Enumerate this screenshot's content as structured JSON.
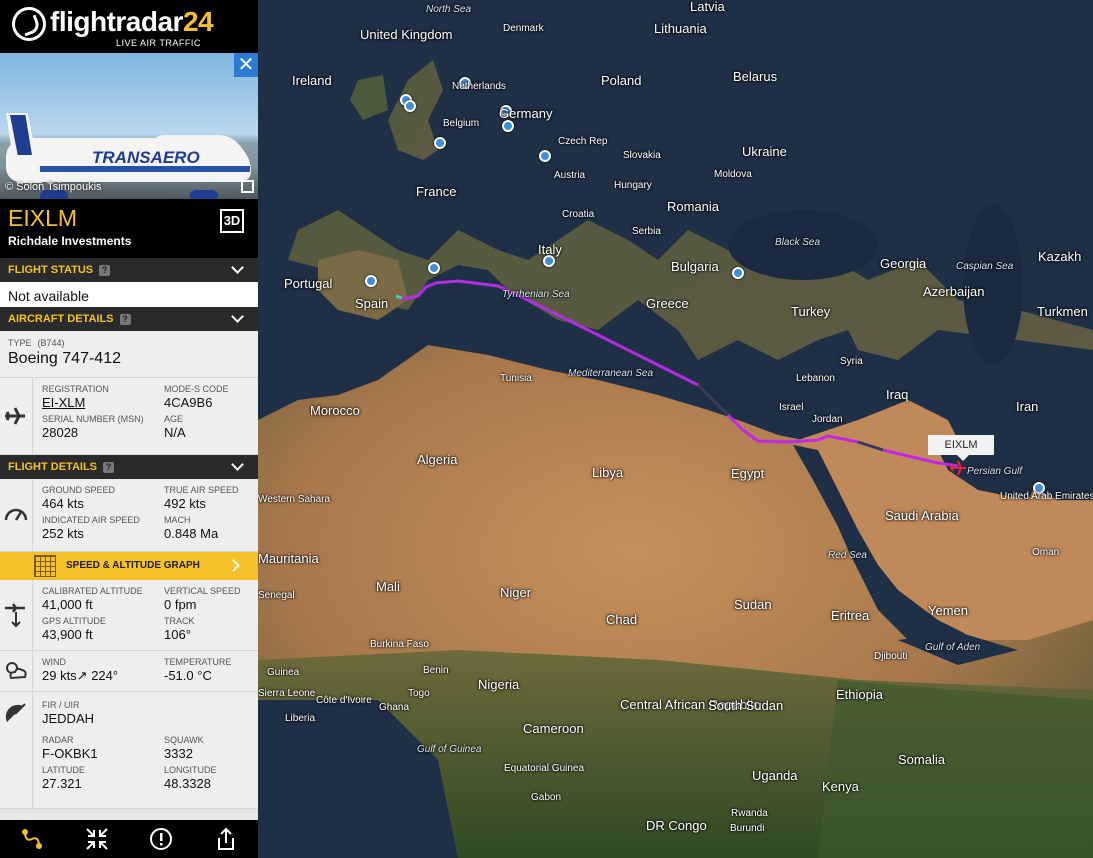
{
  "brand": {
    "logo": "flightradar",
    "logo_num": "24",
    "tagline": "LIVE AIR TRAFFIC"
  },
  "photo": {
    "credit": "© Solon Tsimpoukis",
    "airline_livery": "TRANSAERO"
  },
  "flight": {
    "callsign": "EIXLM",
    "owner": "Richdale Investments",
    "btn_3d": "3D"
  },
  "flight_status": {
    "header": "FLIGHT STATUS",
    "value": "Not available"
  },
  "aircraft_details": {
    "header": "AIRCRAFT DETAILS",
    "type_label": "TYPE",
    "type_code": "(B744)",
    "type_value": "Boeing 747-412",
    "registration_label": "REGISTRATION",
    "registration": "EI-XLM",
    "modes_label": "MODE-S CODE",
    "modes": "4CA9B6",
    "serial_label": "SERIAL NUMBER (MSN)",
    "serial": "28028",
    "age_label": "AGE",
    "age": "N/A"
  },
  "flight_details": {
    "header": "FLIGHT DETAILS",
    "ground_speed_label": "GROUND SPEED",
    "ground_speed": "464 kts",
    "true_air_speed_label": "TRUE AIR SPEED",
    "true_air_speed": "492 kts",
    "ias_label": "INDICATED AIR SPEED",
    "ias": "252 kts",
    "mach_label": "MACH",
    "mach": "0.848 Ma",
    "graph_button": "SPEED & ALTITUDE GRAPH",
    "cal_alt_label": "CALIBRATED ALTITUDE",
    "cal_alt": "41,000 ft",
    "vs_label": "VERTICAL SPEED",
    "vs": "0 fpm",
    "gps_alt_label": "GPS ALTITUDE",
    "gps_alt": "43,900 ft",
    "track_label": "TRACK",
    "track": "106°",
    "wind_label": "WIND",
    "wind": "29 kts↗ 224°",
    "temp_label": "TEMPERATURE",
    "temp": "-51.0 °C",
    "fir_label": "FIR / UIR",
    "fir": "JEDDAH",
    "radar_label": "RADAR",
    "radar": "F-OKBK1",
    "squawk_label": "SQUAWK",
    "squawk": "3332",
    "lat_label": "LATITUDE",
    "lat": "27.321",
    "lon_label": "LONGITUDE",
    "lon": "48.3328"
  },
  "icons": [
    "close-icon",
    "external-link-icon",
    "3d-view-icon",
    "help-icon",
    "chevron-down-icon",
    "plane-icon",
    "speedometer-icon",
    "graph-icon",
    "altitude-icon",
    "weather-icon",
    "radar-icon",
    "route-icon",
    "fullscreen-icon",
    "alert-icon",
    "share-icon"
  ],
  "map": {
    "callout": "EIXLM",
    "colors": {
      "track": "#c227e6",
      "track_start": "#3fd3b0",
      "pin": "#3f8fd8"
    },
    "labels": [
      "North Sea",
      "Latvia",
      "Lithuania",
      "Denmark",
      "United Kingdom",
      "Ireland",
      "Netherlands",
      "Belarus",
      "Poland",
      "Germany",
      "Belgium",
      "Czech Rep",
      "Slovakia",
      "Ukraine",
      "Austria",
      "Hungary",
      "Moldova",
      "France",
      "Croatia",
      "Romania",
      "Serbia",
      "Black Sea",
      "Georgia",
      "Caspian Sea",
      "Kazakh",
      "Italy",
      "Bulgaria",
      "Azerbaijan",
      "Turkmen",
      "Portugal",
      "Spain",
      "Tyrrhenian Sea",
      "Greece",
      "Turkey",
      "Syria",
      "Lebanon",
      "Iraq",
      "Iran",
      "Tunisia",
      "Mediterranean Sea",
      "Israel",
      "Jordan",
      "Morocco",
      "Algeria",
      "Libya",
      "Egypt",
      "Persian Gulf",
      "United Arab Emirates",
      "Saudi Arabia",
      "Oman",
      "Western Sahara",
      "Mauritania",
      "Mali",
      "Niger",
      "Chad",
      "Sudan",
      "Red Sea",
      "Eritrea",
      "Yemen",
      "Gulf of Aden",
      "Djibouti",
      "Senegal",
      "Guinea",
      "Sierra Leone",
      "Liberia",
      "Burkina Faso",
      "Côte d'Ivoire",
      "Ghana",
      "Togo",
      "Benin",
      "Nigeria",
      "Ethiopia",
      "Cameroon",
      "Central African Republic",
      "South Sudan",
      "Gulf of Guinea",
      "Equatorial Guinea",
      "Gabon",
      "Uganda",
      "Kenya",
      "Somalia",
      "DR Congo",
      "Rwanda",
      "Burundi"
    ]
  }
}
